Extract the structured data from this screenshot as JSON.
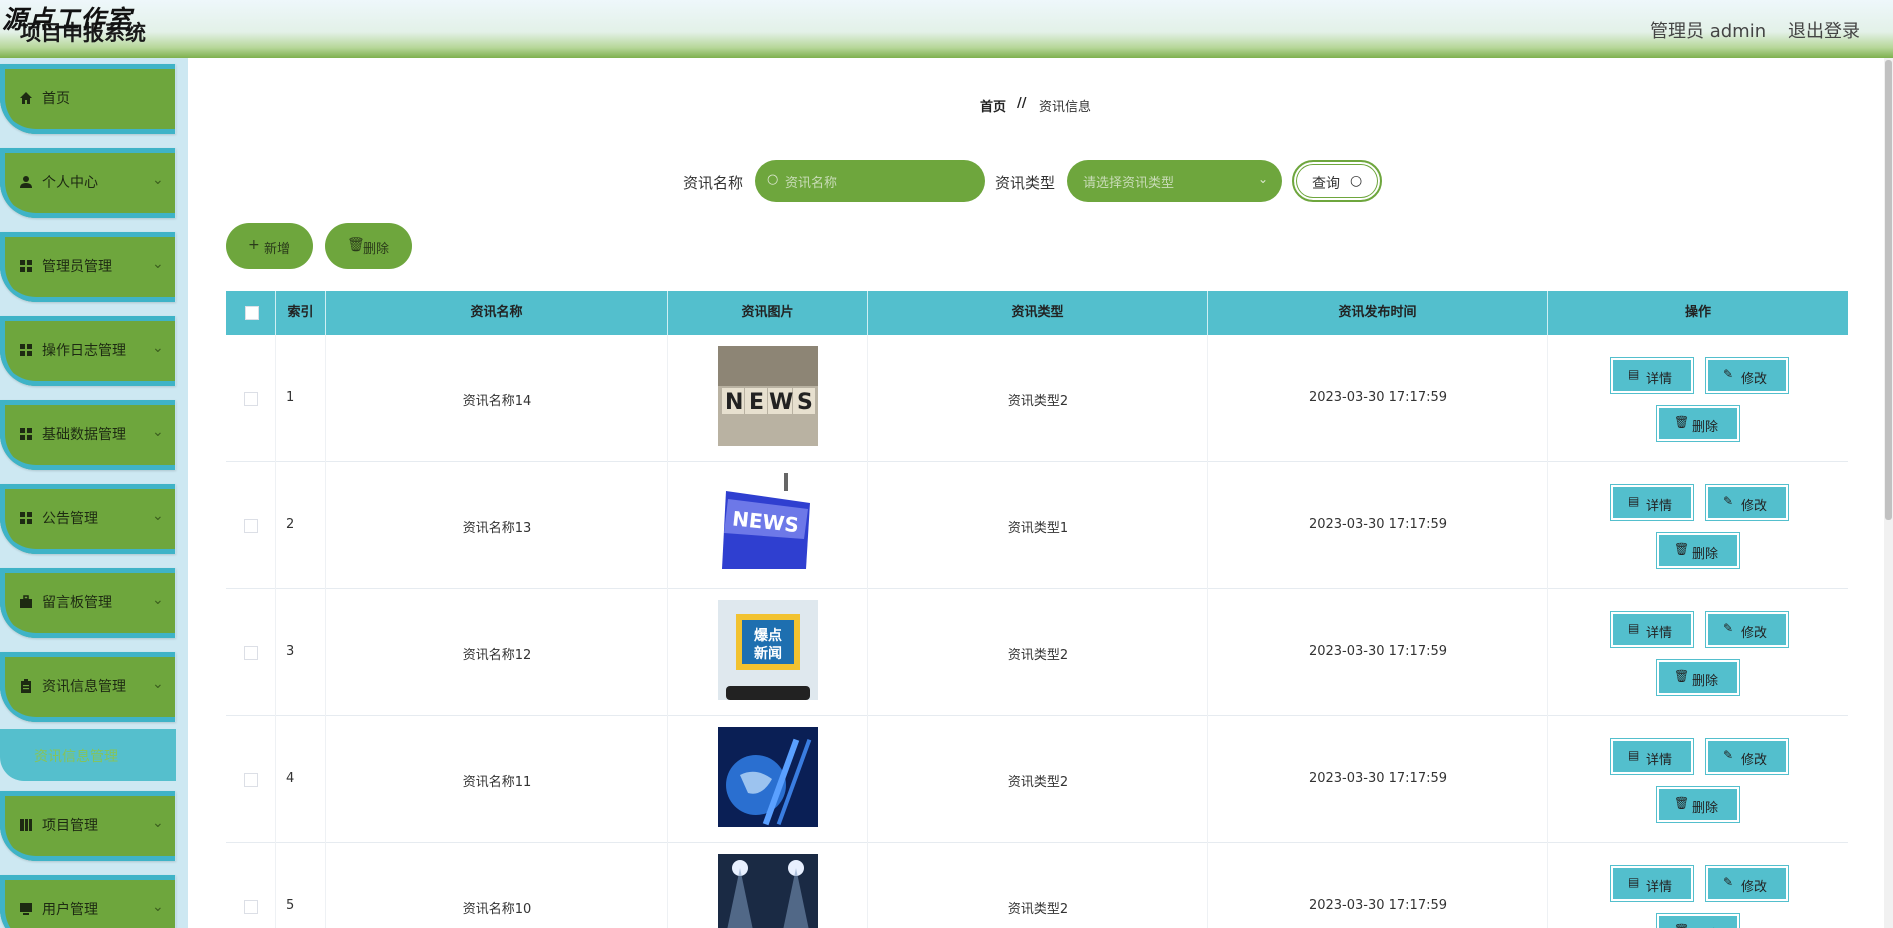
{
  "header": {
    "watermark": "源点工作室",
    "app_title": "项目申报系统",
    "admin_label": "管理员 admin",
    "logout_label": "退出登录"
  },
  "sidebar": {
    "items": [
      {
        "label": "首页",
        "icon": "home-icon",
        "has_arrow": false
      },
      {
        "label": "个人中心",
        "icon": "user-icon",
        "has_arrow": true
      },
      {
        "label": "管理员管理",
        "icon": "grid-icon",
        "has_arrow": true
      },
      {
        "label": "操作日志管理",
        "icon": "grid-icon",
        "has_arrow": true
      },
      {
        "label": "基础数据管理",
        "icon": "grid-icon",
        "has_arrow": true
      },
      {
        "label": "公告管理",
        "icon": "grid-icon",
        "has_arrow": true
      },
      {
        "label": "留言板管理",
        "icon": "briefcase-icon",
        "has_arrow": true
      },
      {
        "label": "资讯信息管理",
        "icon": "clipboard-icon",
        "has_arrow": true
      },
      {
        "label": "项目管理",
        "icon": "book-icon",
        "has_arrow": true
      },
      {
        "label": "用户管理",
        "icon": "monitor-icon",
        "has_arrow": true
      }
    ],
    "active_sub": "资讯信息管理"
  },
  "breadcrumb": {
    "home": "首页",
    "separator": "//",
    "current": "资讯信息"
  },
  "search": {
    "name_label": "资讯名称",
    "name_placeholder": "资讯名称",
    "type_label": "资讯类型",
    "type_placeholder": "请选择资讯类型",
    "query_label": "查询"
  },
  "actions": {
    "add_label": "新增",
    "delete_label": "删除"
  },
  "table": {
    "columns": [
      "索引",
      "资讯名称",
      "资讯图片",
      "资讯类型",
      "资讯发布时间",
      "操作"
    ],
    "op_labels": {
      "detail": "详情",
      "edit": "修改",
      "delete": "删除"
    },
    "rows": [
      {
        "index": "1",
        "name": "资讯名称14",
        "image": "NEWS",
        "type": "资讯类型2",
        "time": "2023-03-30 17:17:59"
      },
      {
        "index": "2",
        "name": "资讯名称13",
        "image": "NEWS",
        "type": "资讯类型1",
        "time": "2023-03-30 17:17:59"
      },
      {
        "index": "3",
        "name": "资讯名称12",
        "image": "爆点新闻",
        "type": "资讯类型2",
        "time": "2023-03-30 17:17:59"
      },
      {
        "index": "4",
        "name": "资讯名称11",
        "image": "",
        "type": "资讯类型2",
        "time": "2023-03-30 17:17:59"
      },
      {
        "index": "5",
        "name": "资讯名称10",
        "image": "",
        "type": "资讯类型2",
        "time": "2023-03-30 17:17:59"
      }
    ]
  },
  "colors": {
    "primary_green": "#6ea63d",
    "accent_teal": "#53bfcd",
    "sidebar_bg": "#cde8f2"
  }
}
